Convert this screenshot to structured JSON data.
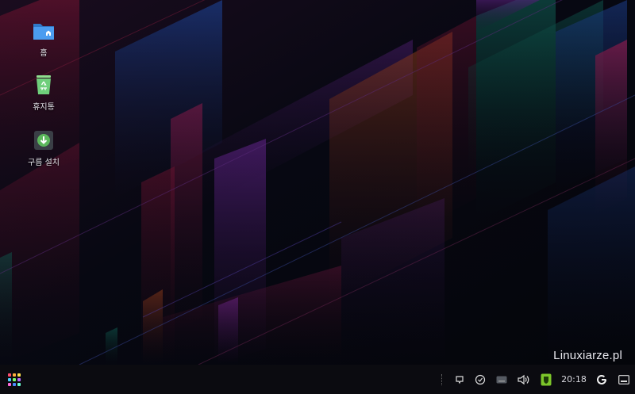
{
  "desktop": {
    "icons": [
      {
        "label": "홈",
        "icon": "home-folder-icon"
      },
      {
        "label": "휴지통",
        "icon": "trash-icon"
      },
      {
        "label": "구름 설치",
        "icon": "install-icon"
      }
    ],
    "watermark": "Linuxiarze.pl"
  },
  "taskbar": {
    "launcher_icon": "app-grid-icon",
    "tray": {
      "icons": [
        "notification-icon",
        "update-icon",
        "keyboard-icon",
        "volume-icon",
        "security-shield-icon",
        "google-icon",
        "show-desktop-icon"
      ],
      "clock": "20:18"
    }
  },
  "colors": {
    "background": "#05060d",
    "taskbar": "#0b0b10",
    "shield": "#7cc62a",
    "folder": "#3d8de0",
    "trash": "#6fcf7b",
    "install": "#5cb85c"
  }
}
